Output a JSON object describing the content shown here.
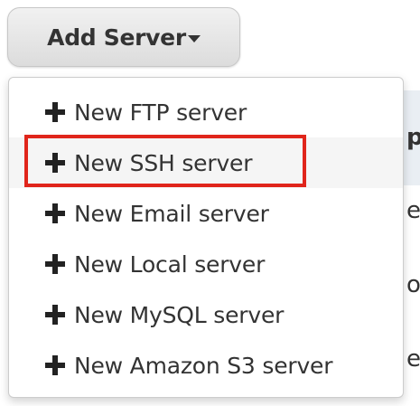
{
  "button": {
    "label": "Add Server"
  },
  "menu": {
    "items": [
      {
        "label": "New FTP server",
        "icon": "plus-icon"
      },
      {
        "label": "New SSH server",
        "icon": "plus-icon"
      },
      {
        "label": "New Email server",
        "icon": "plus-icon"
      },
      {
        "label": "New Local server",
        "icon": "plus-icon"
      },
      {
        "label": "New MySQL server",
        "icon": "plus-icon"
      },
      {
        "label": "New Amazon S3 server",
        "icon": "plus-icon"
      }
    ]
  },
  "background": {
    "fragments": [
      "p",
      "er",
      "or",
      "e"
    ]
  },
  "colors": {
    "highlight_border": "#e0251b",
    "header_band": "#e9eef3"
  }
}
